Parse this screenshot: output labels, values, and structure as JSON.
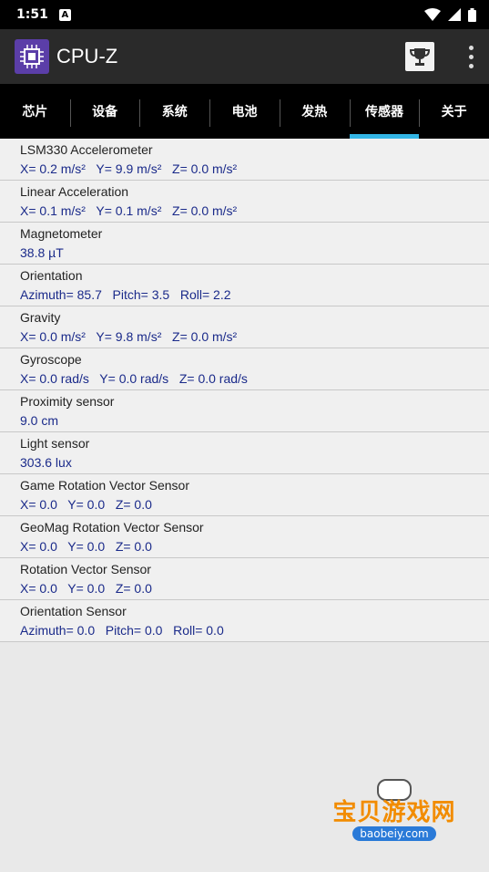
{
  "status_bar": {
    "time": "1:51",
    "notification_icon": "A"
  },
  "app_bar": {
    "title": "CPU-Z"
  },
  "tabs": [
    {
      "label": "芯片"
    },
    {
      "label": "设备"
    },
    {
      "label": "系统"
    },
    {
      "label": "电池"
    },
    {
      "label": "发热"
    },
    {
      "label": "传感器"
    },
    {
      "label": "关于"
    }
  ],
  "active_tab": "传感器",
  "sensors": [
    {
      "name": "LSM330 Accelerometer",
      "value": "X= 0.2 m/s²   Y= 9.9 m/s²   Z= 0.0 m/s²"
    },
    {
      "name": "Linear Acceleration",
      "value": "X= 0.1 m/s²   Y= 0.1 m/s²   Z= 0.0 m/s²"
    },
    {
      "name": "Magnetometer",
      "value": "38.8 µT"
    },
    {
      "name": "Orientation",
      "value": "Azimuth= 85.7   Pitch= 3.5   Roll= 2.2"
    },
    {
      "name": "Gravity",
      "value": "X= 0.0 m/s²   Y= 9.8 m/s²   Z= 0.0 m/s²"
    },
    {
      "name": "Gyroscope",
      "value": "X= 0.0 rad/s   Y= 0.0 rad/s   Z= 0.0 rad/s"
    },
    {
      "name": "Proximity sensor",
      "value": "9.0 cm"
    },
    {
      "name": "Light sensor",
      "value": "303.6 lux"
    },
    {
      "name": "Game Rotation Vector Sensor",
      "value": "X= 0.0   Y= 0.0   Z= 0.0"
    },
    {
      "name": "GeoMag Rotation Vector Sensor",
      "value": "X= 0.0   Y= 0.0   Z= 0.0"
    },
    {
      "name": "Rotation Vector Sensor",
      "value": "X= 0.0   Y= 0.0   Z= 0.0"
    },
    {
      "name": "Orientation Sensor",
      "value": "Azimuth= 0.0   Pitch= 0.0   Roll= 0.0"
    }
  ],
  "watermark": {
    "text": "宝贝游戏网",
    "url": "baobeiy.com"
  },
  "colors": {
    "accent": "#33b5e5",
    "value_text": "#1a2a8a",
    "logo": "#5b3ea8"
  }
}
